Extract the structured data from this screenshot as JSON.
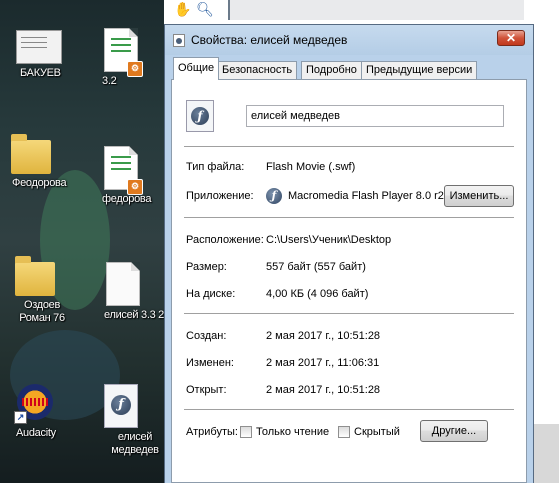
{
  "desktop": {
    "icons": [
      {
        "label": "БАКУЕВ",
        "type": "screenshot"
      },
      {
        "label": "3.2",
        "type": "doc"
      },
      {
        "label": "Феодорова",
        "type": "folder"
      },
      {
        "label": "федорова",
        "type": "doc"
      },
      {
        "label": "Оздоев Роман 76",
        "type": "folder"
      },
      {
        "label": "елисей 3.3 2",
        "type": "blank-doc"
      },
      {
        "label": "Audacity",
        "type": "app"
      },
      {
        "label": "елисей медведев",
        "type": "swf"
      }
    ]
  },
  "dialog": {
    "title": "Свойства: елисей медведев",
    "close_glyph": "✕",
    "tabs": [
      "Общие",
      "Безопасность",
      "Подробно",
      "Предыдущие версии"
    ],
    "file_name": "елисей медведев",
    "file_type_label": "Тип файла:",
    "file_type_value": "Flash Movie (.swf)",
    "app_label": "Приложение:",
    "app_value": "Macromedia Flash Player 8.0  r22",
    "change_button": "Изменить...",
    "location_label": "Расположение:",
    "location_value": "C:\\Users\\Ученик\\Desktop",
    "size_label": "Размер:",
    "size_value": "557 байт (557 байт)",
    "disk_label": "На диске:",
    "disk_value": "4,00 КБ (4 096 байт)",
    "created_label": "Создан:",
    "created_value": "2 мая 2017 г., 10:51:28",
    "modified_label": "Изменен:",
    "modified_value": "2 мая 2017 г., 11:06:31",
    "opened_label": "Открыт:",
    "opened_value": "2 мая 2017 г., 10:51:28",
    "attributes_label": "Атрибуты:",
    "readonly_label": "Только чтение",
    "hidden_label": "Скрытый",
    "other_button": "Другие..."
  },
  "colors": {
    "title_bg": "#b9d1ea",
    "close_button": "#c7401f",
    "desktop_bg": "#233335"
  }
}
